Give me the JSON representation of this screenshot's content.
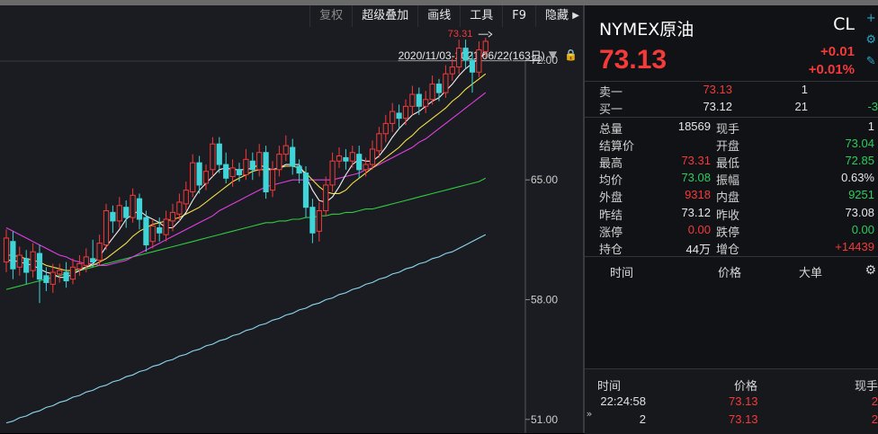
{
  "toolbar": {
    "items": [
      "复权",
      "超级叠加",
      "画线",
      "工具",
      "F9",
      "隐藏"
    ],
    "more_icon": "triangle-right-icon"
  },
  "range": {
    "text": "2020/11/03-2021/06/22(163日)",
    "dropdown_icon": "triangle-down-icon",
    "lock_icon": "lock-icon"
  },
  "chart": {
    "last_marker": "73.31",
    "y_ticks": [
      "72.00",
      "65.00",
      "58.00",
      "51.00"
    ]
  },
  "quote": {
    "title": "NYMEX原油",
    "code": "CL",
    "price": "73.13",
    "change": "+0.01",
    "change_pct": "+0.01%"
  },
  "orderbook": [
    {
      "label": "卖一",
      "price": "73.13",
      "vol": "1",
      "extra": ""
    },
    {
      "label": "买一",
      "price": "73.12",
      "vol": "21",
      "extra": "-3"
    }
  ],
  "stats": [
    {
      "l1": "总量",
      "v1": "18569",
      "c1": "white",
      "l2": "现手",
      "v2": "1",
      "c2": "white"
    },
    {
      "l1": "结算价",
      "v1": "",
      "c1": "white",
      "l2": "开盘",
      "v2": "73.04",
      "c2": "green"
    },
    {
      "l1": "最高",
      "v1": "73.31",
      "c1": "red",
      "l2": "最低",
      "v2": "72.85",
      "c2": "green"
    },
    {
      "l1": "均价",
      "v1": "73.08",
      "c1": "green",
      "l2": "振幅",
      "v2": "0.63%",
      "c2": "white"
    },
    {
      "l1": "外盘",
      "v1": "9318",
      "c1": "red",
      "l2": "内盘",
      "v2": "9251",
      "c2": "green"
    },
    {
      "l1": "昨结",
      "v1": "73.12",
      "c1": "white",
      "l2": "昨收",
      "v2": "73.08",
      "c2": "white"
    },
    {
      "l1": "涨停",
      "v1": "0.00",
      "c1": "red",
      "l2": "跌停",
      "v2": "0.00",
      "c2": "green"
    },
    {
      "l1": "持仓",
      "v1": "44万",
      "c1": "white",
      "l2": "增仓",
      "v2": "+14439",
      "c2": "red"
    }
  ],
  "ticks_header": {
    "time": "时间",
    "price": "价格",
    "big": "大单"
  },
  "trades": {
    "header": {
      "time": "时间",
      "price": "价格",
      "qty": "现手"
    },
    "rows": [
      {
        "time": "22:24:58",
        "price": "73.13",
        "qty": "2"
      },
      {
        "time": "2",
        "price": "73.13",
        "qty": "2"
      }
    ]
  },
  "colors": {
    "up": "#f53a3a",
    "down": "#3fd4d8",
    "ma5": "#f0f0f0",
    "ma10": "#f5e14a",
    "ma20": "#e040e0",
    "ma60": "#2ecc40",
    "ma120": "#8ad8ee"
  },
  "chart_data": {
    "type": "candlestick",
    "ylim": [
      50.2,
      75.2
    ],
    "y_ticks": [
      72,
      65,
      58,
      51
    ],
    "candles": [
      {
        "o": 60.2,
        "c": 61.6,
        "h": 62.1,
        "l": 59.6
      },
      {
        "o": 61.4,
        "c": 59.8,
        "h": 62.0,
        "l": 59.2
      },
      {
        "o": 59.9,
        "c": 60.6,
        "h": 61.1,
        "l": 59.4
      },
      {
        "o": 60.4,
        "c": 59.6,
        "h": 60.9,
        "l": 58.9
      },
      {
        "o": 59.7,
        "c": 60.8,
        "h": 61.3,
        "l": 59.3
      },
      {
        "o": 60.7,
        "c": 59.2,
        "h": 61.2,
        "l": 57.8
      },
      {
        "o": 59.4,
        "c": 59.0,
        "h": 59.9,
        "l": 58.5
      },
      {
        "o": 58.9,
        "c": 59.6,
        "h": 60.1,
        "l": 58.4
      },
      {
        "o": 59.5,
        "c": 59.7,
        "h": 60.1,
        "l": 59.0
      },
      {
        "o": 59.6,
        "c": 59.1,
        "h": 60.2,
        "l": 58.7
      },
      {
        "o": 59.2,
        "c": 59.9,
        "h": 60.4,
        "l": 58.9
      },
      {
        "o": 59.8,
        "c": 60.1,
        "h": 60.6,
        "l": 59.4
      },
      {
        "o": 60.0,
        "c": 60.5,
        "h": 61.0,
        "l": 59.6
      },
      {
        "o": 60.4,
        "c": 60.2,
        "h": 61.5,
        "l": 59.9
      },
      {
        "o": 60.3,
        "c": 61.3,
        "h": 61.8,
        "l": 60.0
      },
      {
        "o": 61.2,
        "c": 63.2,
        "h": 63.6,
        "l": 60.9
      },
      {
        "o": 63.1,
        "c": 62.6,
        "h": 63.5,
        "l": 61.9
      },
      {
        "o": 62.6,
        "c": 63.5,
        "h": 64.0,
        "l": 62.2
      },
      {
        "o": 63.4,
        "c": 62.8,
        "h": 63.8,
        "l": 62.2
      },
      {
        "o": 62.8,
        "c": 64.1,
        "h": 64.5,
        "l": 62.5
      },
      {
        "o": 63.9,
        "c": 62.7,
        "h": 64.2,
        "l": 62.1
      },
      {
        "o": 62.8,
        "c": 61.2,
        "h": 63.2,
        "l": 60.8
      },
      {
        "o": 61.4,
        "c": 62.3,
        "h": 62.7,
        "l": 61.0
      },
      {
        "o": 62.2,
        "c": 61.9,
        "h": 62.8,
        "l": 61.4
      },
      {
        "o": 61.8,
        "c": 62.7,
        "h": 63.2,
        "l": 61.4
      },
      {
        "o": 62.6,
        "c": 63.1,
        "h": 63.6,
        "l": 62.0
      },
      {
        "o": 63.0,
        "c": 63.7,
        "h": 64.2,
        "l": 62.6
      },
      {
        "o": 63.6,
        "c": 64.4,
        "h": 64.9,
        "l": 63.2
      },
      {
        "o": 64.3,
        "c": 66.0,
        "h": 66.5,
        "l": 64.0
      },
      {
        "o": 66.0,
        "c": 64.7,
        "h": 66.4,
        "l": 64.2
      },
      {
        "o": 64.8,
        "c": 65.5,
        "h": 65.9,
        "l": 64.4
      },
      {
        "o": 65.6,
        "c": 67.1,
        "h": 67.5,
        "l": 65.2
      },
      {
        "o": 67.1,
        "c": 65.9,
        "h": 67.5,
        "l": 65.4
      },
      {
        "o": 65.9,
        "c": 65.1,
        "h": 66.6,
        "l": 64.8
      },
      {
        "o": 65.2,
        "c": 65.7,
        "h": 66.2,
        "l": 64.6
      },
      {
        "o": 65.6,
        "c": 65.3,
        "h": 66.0,
        "l": 64.9
      },
      {
        "o": 65.3,
        "c": 66.2,
        "h": 66.8,
        "l": 65.0
      },
      {
        "o": 66.1,
        "c": 65.6,
        "h": 66.6,
        "l": 65.0
      },
      {
        "o": 65.6,
        "c": 66.6,
        "h": 67.1,
        "l": 65.2
      },
      {
        "o": 66.6,
        "c": 64.3,
        "h": 67.0,
        "l": 63.9
      },
      {
        "o": 64.4,
        "c": 65.6,
        "h": 66.1,
        "l": 64.0
      },
      {
        "o": 65.6,
        "c": 66.5,
        "h": 67.0,
        "l": 65.2
      },
      {
        "o": 66.5,
        "c": 67.0,
        "h": 67.6,
        "l": 66.1
      },
      {
        "o": 66.9,
        "c": 65.8,
        "h": 67.4,
        "l": 65.3
      },
      {
        "o": 65.8,
        "c": 65.4,
        "h": 66.2,
        "l": 64.8
      },
      {
        "o": 65.4,
        "c": 63.4,
        "h": 65.8,
        "l": 62.8
      },
      {
        "o": 63.4,
        "c": 61.9,
        "h": 63.9,
        "l": 61.3
      },
      {
        "o": 62.0,
        "c": 63.2,
        "h": 63.7,
        "l": 61.4
      },
      {
        "o": 63.2,
        "c": 64.7,
        "h": 65.2,
        "l": 62.9
      },
      {
        "o": 64.7,
        "c": 66.1,
        "h": 66.6,
        "l": 64.3
      },
      {
        "o": 66.1,
        "c": 66.4,
        "h": 66.9,
        "l": 65.7
      },
      {
        "o": 66.3,
        "c": 66.1,
        "h": 66.8,
        "l": 65.6
      },
      {
        "o": 66.1,
        "c": 66.6,
        "h": 67.0,
        "l": 65.7
      },
      {
        "o": 66.5,
        "c": 65.6,
        "h": 67.0,
        "l": 65.1
      },
      {
        "o": 65.6,
        "c": 65.9,
        "h": 66.3,
        "l": 65.2
      },
      {
        "o": 65.9,
        "c": 66.8,
        "h": 67.3,
        "l": 65.6
      },
      {
        "o": 66.7,
        "c": 67.7,
        "h": 68.1,
        "l": 66.3
      },
      {
        "o": 67.7,
        "c": 68.3,
        "h": 68.8,
        "l": 67.2
      },
      {
        "o": 68.3,
        "c": 69.0,
        "h": 69.5,
        "l": 67.8
      },
      {
        "o": 68.9,
        "c": 68.6,
        "h": 69.4,
        "l": 68.0
      },
      {
        "o": 68.6,
        "c": 69.3,
        "h": 69.7,
        "l": 68.2
      },
      {
        "o": 69.3,
        "c": 70.0,
        "h": 70.5,
        "l": 68.8
      },
      {
        "o": 70.0,
        "c": 69.3,
        "h": 70.4,
        "l": 68.8
      },
      {
        "o": 69.3,
        "c": 69.7,
        "h": 70.2,
        "l": 68.9
      },
      {
        "o": 69.7,
        "c": 70.6,
        "h": 71.1,
        "l": 69.4
      },
      {
        "o": 70.6,
        "c": 70.1,
        "h": 70.9,
        "l": 69.6
      },
      {
        "o": 70.1,
        "c": 71.2,
        "h": 71.7,
        "l": 69.8
      },
      {
        "o": 71.2,
        "c": 71.6,
        "h": 72.1,
        "l": 70.8
      },
      {
        "o": 71.6,
        "c": 72.7,
        "h": 73.2,
        "l": 71.2
      },
      {
        "o": 72.7,
        "c": 72.0,
        "h": 73.2,
        "l": 71.5
      },
      {
        "o": 72.0,
        "c": 71.3,
        "h": 72.5,
        "l": 70.1
      },
      {
        "o": 71.3,
        "c": 72.6,
        "h": 73.1,
        "l": 71.0
      },
      {
        "o": 72.5,
        "c": 73.1,
        "h": 73.3,
        "l": 72.1
      }
    ],
    "ma5": [
      60.3,
      60.3,
      60.2,
      60.1,
      60.0,
      59.8,
      59.6,
      59.5,
      59.3,
      59.3,
      59.5,
      59.7,
      59.9,
      60.1,
      60.5,
      61.1,
      61.6,
      62.1,
      62.7,
      63.0,
      63.2,
      62.9,
      62.7,
      62.5,
      62.2,
      62.2,
      62.6,
      63.1,
      63.8,
      64.4,
      64.8,
      65.2,
      65.6,
      65.7,
      65.6,
      65.6,
      65.6,
      65.7,
      65.9,
      65.7,
      65.6,
      65.7,
      65.9,
      65.9,
      65.9,
      65.2,
      64.4,
      63.8,
      63.7,
      64.0,
      64.6,
      65.3,
      65.9,
      66.2,
      66.1,
      66.1,
      66.4,
      66.9,
      67.5,
      68.0,
      68.4,
      68.8,
      69.0,
      69.3,
      69.6,
      69.8,
      70.2,
      70.6,
      71.1,
      71.5,
      71.8,
      72.1,
      72.4
    ],
    "ma10": [
      60.6,
      60.6,
      60.5,
      60.4,
      60.3,
      60.2,
      60.0,
      59.9,
      59.8,
      59.7,
      59.7,
      59.8,
      59.9,
      60.0,
      60.2,
      60.4,
      60.7,
      61.0,
      61.3,
      61.7,
      62.0,
      62.2,
      62.4,
      62.5,
      62.6,
      62.7,
      62.8,
      63.0,
      63.2,
      63.4,
      63.7,
      64.0,
      64.3,
      64.6,
      64.9,
      65.1,
      65.3,
      65.5,
      65.6,
      65.6,
      65.6,
      65.7,
      65.8,
      65.8,
      65.7,
      65.4,
      65.0,
      64.6,
      64.3,
      64.2,
      64.2,
      64.4,
      64.8,
      65.1,
      65.4,
      65.7,
      66.0,
      66.3,
      66.6,
      66.9,
      67.3,
      67.6,
      68.0,
      68.3,
      68.6,
      68.9,
      69.2,
      69.6,
      69.9,
      70.3,
      70.6,
      70.9,
      71.2
    ],
    "ma20": [
      62.2,
      62.0,
      61.8,
      61.6,
      61.4,
      61.2,
      61.0,
      60.8,
      60.6,
      60.5,
      60.3,
      60.2,
      60.1,
      60.1,
      60.0,
      60.0,
      60.1,
      60.2,
      60.3,
      60.5,
      60.7,
      60.9,
      61.1,
      61.3,
      61.5,
      61.7,
      61.9,
      62.1,
      62.3,
      62.5,
      62.7,
      62.9,
      63.2,
      63.4,
      63.6,
      63.8,
      64.0,
      64.2,
      64.4,
      64.6,
      64.7,
      64.8,
      64.9,
      65.0,
      65.0,
      65.0,
      65.0,
      65.0,
      65.0,
      65.0,
      65.1,
      65.2,
      65.3,
      65.4,
      65.6,
      65.7,
      65.9,
      66.1,
      66.3,
      66.5,
      66.7,
      66.9,
      67.2,
      67.4,
      67.7,
      68.0,
      68.3,
      68.6,
      68.9,
      69.2,
      69.5,
      69.8,
      70.1
    ],
    "ma60": [
      58.6,
      58.7,
      58.8,
      58.9,
      59.0,
      59.1,
      59.2,
      59.3,
      59.4,
      59.5,
      59.6,
      59.7,
      59.8,
      59.9,
      60.0,
      60.1,
      60.2,
      60.3,
      60.4,
      60.5,
      60.6,
      60.7,
      60.8,
      60.9,
      61.0,
      61.1,
      61.2,
      61.3,
      61.4,
      61.5,
      61.6,
      61.7,
      61.8,
      61.9,
      62.0,
      62.1,
      62.2,
      62.3,
      62.4,
      62.5,
      62.5,
      62.6,
      62.6,
      62.7,
      62.7,
      62.8,
      62.8,
      62.9,
      62.9,
      63.0,
      63.0,
      63.1,
      63.1,
      63.2,
      63.3,
      63.3,
      63.4,
      63.5,
      63.6,
      63.7,
      63.8,
      63.9,
      64.0,
      64.1,
      64.2,
      64.3,
      64.4,
      64.5,
      64.6,
      64.7,
      64.8,
      64.9,
      65.1
    ],
    "ma120": [
      50.8,
      50.9,
      51.1,
      51.2,
      51.4,
      51.5,
      51.7,
      51.8,
      52.0,
      52.1,
      52.3,
      52.4,
      52.6,
      52.7,
      52.9,
      53.0,
      53.2,
      53.3,
      53.5,
      53.6,
      53.8,
      53.9,
      54.1,
      54.2,
      54.4,
      54.5,
      54.7,
      54.8,
      55.0,
      55.1,
      55.3,
      55.4,
      55.6,
      55.7,
      55.9,
      56.0,
      56.2,
      56.3,
      56.5,
      56.6,
      56.8,
      56.9,
      57.1,
      57.2,
      57.4,
      57.5,
      57.7,
      57.8,
      58.0,
      58.1,
      58.3,
      58.4,
      58.6,
      58.7,
      58.9,
      59.0,
      59.2,
      59.3,
      59.5,
      59.6,
      59.8,
      59.9,
      60.1,
      60.2,
      60.4,
      60.5,
      60.7,
      60.8,
      61.0,
      61.2,
      61.4,
      61.6,
      61.8
    ]
  }
}
